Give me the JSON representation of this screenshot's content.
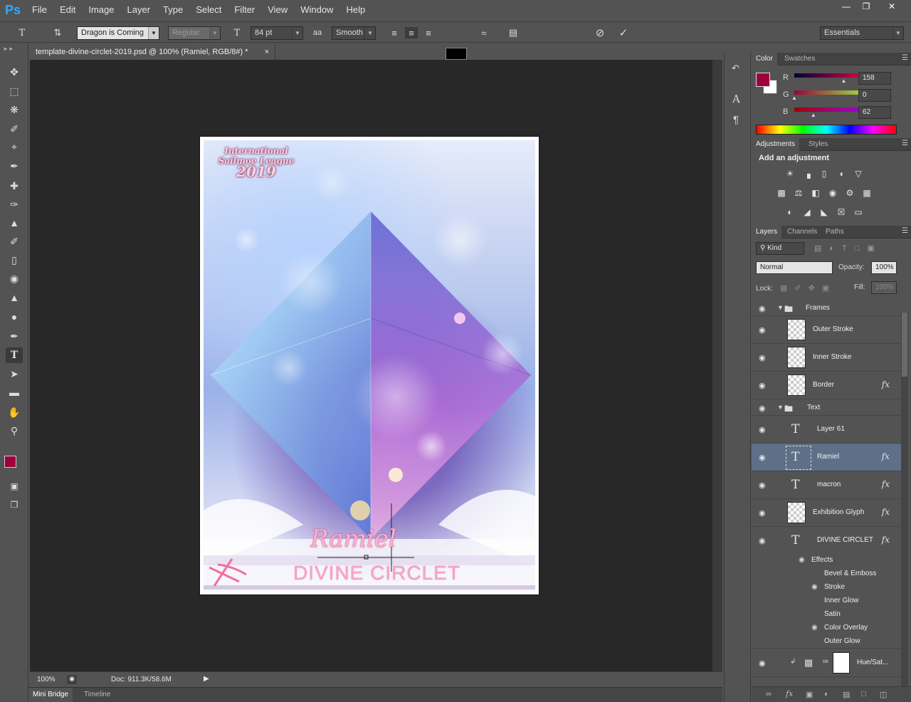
{
  "app": {
    "logo": "Ps",
    "menu": [
      "File",
      "Edit",
      "Image",
      "Layer",
      "Type",
      "Select",
      "Filter",
      "View",
      "Window",
      "Help"
    ]
  },
  "options": {
    "font_family": "Dragon is Coming",
    "font_style": "Regular",
    "font_size": "84 pt",
    "antialias": "Smooth",
    "workspace": "Essentials"
  },
  "document": {
    "tab_title": "template-divine-circlet-2019.psd @ 100% (Ramiel, RGB/8#) *",
    "zoom": "100%",
    "doc_info": "Doc: 911.3K/58.6M",
    "art": {
      "logo_line1": "International",
      "logo_line2": "Sailmoe League",
      "logo_year": "2019",
      "name": "Ramiel",
      "title": "DIVINE CIRCLET"
    }
  },
  "bottom_tabs": [
    "Mini Bridge",
    "Timeline"
  ],
  "color_panel": {
    "tabs": [
      "Color",
      "Swatches"
    ],
    "r_label": "R",
    "g_label": "G",
    "b_label": "B",
    "r": "158",
    "g": "0",
    "b": "62",
    "r_fraction": 0.62,
    "g_fraction": 0.0,
    "b_fraction": 0.24,
    "fg_color": "#9e003e",
    "bg_color": "#ffffff"
  },
  "adjustments_panel": {
    "tabs": [
      "Adjustments",
      "Styles"
    ],
    "heading": "Add an adjustment"
  },
  "layers_panel": {
    "tabs": [
      "Layers",
      "Channels",
      "Paths"
    ],
    "filter_kind": "Kind",
    "blend_mode": "Normal",
    "opacity_label": "Opacity:",
    "opacity": "100%",
    "lock_label": "Lock:",
    "fill_label": "Fill:",
    "fill": "100%",
    "groups": {
      "frames": "Frames",
      "text": "Text"
    },
    "layers": {
      "outer_stroke": "Outer Stroke",
      "inner_stroke": "Inner Stroke",
      "border": "Border",
      "layer61": "Layer 61",
      "ramiel": "Ramiel",
      "macron": "macron",
      "glyph": "Exhibition Glyph",
      "divine": "DIVINE CIRCLET",
      "huesat": "Hue/Sat..."
    },
    "fx_label": "fx",
    "effects_label": "Effects",
    "effects": [
      "Bevel & Emboss",
      "Stroke",
      "Inner Glow",
      "Satin",
      "Color Overlay",
      "Outer Glow"
    ]
  }
}
